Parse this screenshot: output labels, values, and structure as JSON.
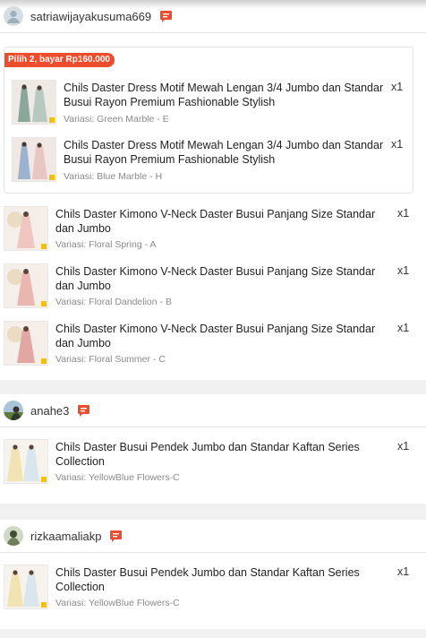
{
  "groups": [
    {
      "username": "satriawijayakusuma669",
      "bundle_badge": "Pilih 2, bayar Rp160.000",
      "bundle_items": [
        {
          "title": "Chils Daster Dress Motif Mewah Lengan 3/4 Jumbo dan Standar Busui Rayon Premium Fashionable Stylish",
          "variant": "Variasi: Green Marble - E",
          "qty": "x1"
        },
        {
          "title": "Chils Daster Dress Motif Mewah Lengan 3/4 Jumbo dan Standar Busui Rayon Premium Fashionable Stylish",
          "variant": "Variasi: Blue Marble - H",
          "qty": "x1"
        }
      ],
      "items": [
        {
          "title": "Chils Daster Kimono V-Neck Daster Busui Panjang Size Standar dan Jumbo",
          "variant": "Variasi: Floral Spring - A",
          "qty": "x1"
        },
        {
          "title": "Chils Daster Kimono V-Neck Daster Busui Panjang Size Standar dan Jumbo",
          "variant": "Variasi: Floral Dandelion - B",
          "qty": "x1"
        },
        {
          "title": "Chils Daster Kimono V-Neck Daster Busui Panjang Size Standar dan Jumbo",
          "variant": "Variasi: Floral Summer - C",
          "qty": "x1"
        }
      ]
    },
    {
      "username": "anahe3",
      "items": [
        {
          "title": "Chils Daster Busui Pendek Jumbo dan Standar Kaftan Series Collection",
          "variant": "Variasi: YellowBlue Flowers-C",
          "qty": "x1"
        }
      ]
    },
    {
      "username": "rizkaamaliakp",
      "items": [
        {
          "title": "Chils Daster Busui Pendek Jumbo dan Standar Kaftan Series Collection",
          "variant": "Variasi: YellowBlue Flowers-C",
          "qty": "x1"
        }
      ]
    }
  ],
  "icons": {
    "chat": "chat-bubble-icon",
    "avatar_default": "default-avatar-icon"
  },
  "colors": {
    "accent": "#ee4d2d",
    "muted_text": "#8a8a8a"
  }
}
